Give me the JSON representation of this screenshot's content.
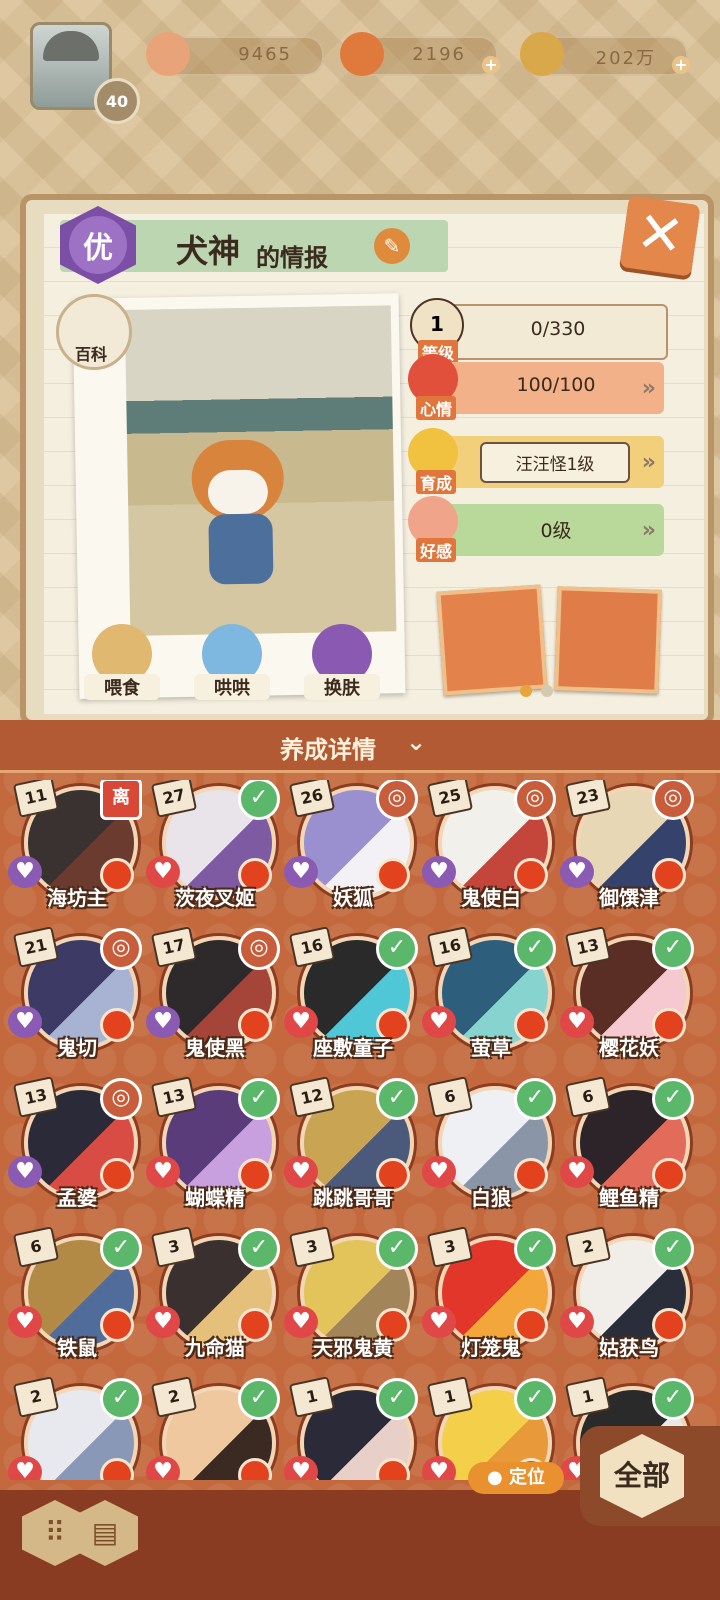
{
  "player": {
    "level": "40"
  },
  "resources": [
    {
      "name": "jade",
      "value": "9465",
      "icon": "flower-jade-icon",
      "color": "#e8a478"
    },
    {
      "name": "stamina",
      "value": "2196",
      "icon": "stamina-icon",
      "color": "#e07a3c"
    },
    {
      "name": "coins",
      "value": "202万",
      "icon": "coin-icon",
      "color": "#d9a84a"
    }
  ],
  "card": {
    "grade": "优",
    "name": "犬神",
    "name_suffix": "的情报",
    "baike_label": "百科",
    "actions": [
      {
        "label": "喂食",
        "icon": "noodle-bowl-icon",
        "color": "#e0b870"
      },
      {
        "label": "哄哄",
        "icon": "milk-carton-icon",
        "color": "#7eb7df"
      },
      {
        "label": "换肤",
        "icon": "skin-swap-icon",
        "color": "#8a5ab2"
      }
    ],
    "stats": [
      {
        "key": "level",
        "label": "等级",
        "value": "0/330",
        "icon_text": "1",
        "bg": "#f3ead6",
        "icon_color": "#f0e2c5"
      },
      {
        "key": "mood",
        "label": "心情",
        "value": "100/100",
        "icon_text": "",
        "bg": "#f3b18a",
        "icon_color": "#e0503a"
      },
      {
        "key": "growth",
        "label": "育成",
        "value": "汪汪怪1级",
        "icon_text": "",
        "bg": "#f1cf7b",
        "icon_color": "#f0c240"
      },
      {
        "key": "affection",
        "label": "好感",
        "value": "0级",
        "icon_text": "",
        "bg": "#b8d99a",
        "icon_color": "#f0a58a"
      }
    ],
    "page_dots": [
      {
        "color": "#e8a63a"
      },
      {
        "color": "#d6c9b2"
      }
    ]
  },
  "detail_label": "养成详情",
  "shikigami": [
    {
      "name": "海坊主",
      "level": "11",
      "badge": "离",
      "badge_type": "away",
      "heart_color": "#8b5ab3",
      "colors": [
        "#3a3230",
        "#6b3b30"
      ]
    },
    {
      "name": "茨夜叉姬",
      "level": "27",
      "badge": "✓",
      "badge_type": "check",
      "heart_color": "#e04848",
      "colors": [
        "#e8e4ea",
        "#7e5aa2"
      ]
    },
    {
      "name": "妖狐",
      "level": "26",
      "badge": "◎",
      "badge_type": "ring",
      "heart_color": "#8b5ab3",
      "colors": [
        "#9a8fcf",
        "#f3f1f5"
      ]
    },
    {
      "name": "鬼使白",
      "level": "25",
      "badge": "◎",
      "badge_type": "ring",
      "heart_color": "#8b5ab3",
      "colors": [
        "#f2f0ea",
        "#c4453a"
      ]
    },
    {
      "name": "御馔津",
      "level": "23",
      "badge": "◎",
      "badge_type": "ring",
      "heart_color": "#8b5ab3",
      "colors": [
        "#e8d7b5",
        "#35436c"
      ]
    },
    {
      "name": "鬼切",
      "level": "21",
      "badge": "◎",
      "badge_type": "ring",
      "heart_color": "#8b5ab3",
      "colors": [
        "#3d3b66",
        "#a8b3d4"
      ]
    },
    {
      "name": "鬼使黑",
      "level": "17",
      "badge": "◎",
      "badge_type": "ring",
      "heart_color": "#8b5ab3",
      "colors": [
        "#2e2a2c",
        "#a5453a"
      ]
    },
    {
      "name": "座敷童子",
      "level": "16",
      "badge": "✓",
      "badge_type": "check",
      "heart_color": "#e04848",
      "colors": [
        "#2a2a2a",
        "#4fc7d6"
      ]
    },
    {
      "name": "萤草",
      "level": "16",
      "badge": "✓",
      "badge_type": "check",
      "heart_color": "#e04848",
      "colors": [
        "#2d5f7d",
        "#86d3cf"
      ]
    },
    {
      "name": "樱花妖",
      "level": "13",
      "badge": "✓",
      "badge_type": "check",
      "heart_color": "#e04848",
      "colors": [
        "#5a2e24",
        "#f6c8cf"
      ]
    },
    {
      "name": "孟婆",
      "level": "13",
      "badge": "◎",
      "badge_type": "ring",
      "heart_color": "#8b5ab3",
      "colors": [
        "#2b2a38",
        "#d94c43"
      ]
    },
    {
      "name": "蝴蝶精",
      "level": "13",
      "badge": "✓",
      "badge_type": "check",
      "heart_color": "#e04848",
      "colors": [
        "#5b3c7a",
        "#c8a0e0"
      ]
    },
    {
      "name": "跳跳哥哥",
      "level": "12",
      "badge": "✓",
      "badge_type": "check",
      "heart_color": "#e04848",
      "colors": [
        "#c9a453",
        "#4b5a7a"
      ]
    },
    {
      "name": "白狼",
      "level": "6",
      "badge": "✓",
      "badge_type": "check",
      "heart_color": "#e04848",
      "colors": [
        "#eef0f4",
        "#8a95a8"
      ]
    },
    {
      "name": "鲤鱼精",
      "level": "6",
      "badge": "✓",
      "badge_type": "check",
      "heart_color": "#e04848",
      "colors": [
        "#2c2428",
        "#e36b5a"
      ]
    },
    {
      "name": "铁鼠",
      "level": "6",
      "badge": "✓",
      "badge_type": "check",
      "heart_color": "#e04848",
      "colors": [
        "#b28a46",
        "#4f6c9a"
      ]
    },
    {
      "name": "九命猫",
      "level": "3",
      "badge": "✓",
      "badge_type": "check",
      "heart_color": "#e04848",
      "colors": [
        "#3a3030",
        "#e4c07a"
      ]
    },
    {
      "name": "天邪鬼黄",
      "level": "3",
      "badge": "✓",
      "badge_type": "check",
      "heart_color": "#e04848",
      "colors": [
        "#e3c45a",
        "#a3855a"
      ]
    },
    {
      "name": "灯笼鬼",
      "level": "3",
      "badge": "✓",
      "badge_type": "check",
      "heart_color": "#e04848",
      "colors": [
        "#e2362a",
        "#f3a63a"
      ]
    },
    {
      "name": "姑获鸟",
      "level": "2",
      "badge": "✓",
      "badge_type": "check",
      "heart_color": "#e04848",
      "colors": [
        "#f1eee9",
        "#2a2e3a"
      ]
    },
    {
      "name": "",
      "level": "2",
      "badge": "✓",
      "badge_type": "check",
      "heart_color": "#e04848",
      "colors": [
        "#e8e9ef",
        "#8a98b8"
      ]
    },
    {
      "name": "",
      "level": "2",
      "badge": "✓",
      "badge_type": "check",
      "heart_color": "#e04848",
      "colors": [
        "#f0c8a0",
        "#3a2a22"
      ]
    },
    {
      "name": "",
      "level": "1",
      "badge": "✓",
      "badge_type": "check",
      "heart_color": "#e04848",
      "colors": [
        "#2a2a38",
        "#e8d0c8"
      ]
    },
    {
      "name": "",
      "level": "1",
      "badge": "✓",
      "badge_type": "check",
      "heart_color": "#e04848",
      "colors": [
        "#f4d04a",
        "#e89a3a"
      ]
    },
    {
      "name": "",
      "level": "1",
      "badge": "✓",
      "badge_type": "check",
      "heart_color": "#e04848",
      "colors": [
        "#2a2a2a",
        "#e8e8e8"
      ]
    }
  ],
  "locate_label": "定位",
  "all_label": "全部",
  "view_modes": [
    {
      "icon": "grid-view-icon",
      "glyph": "⠿"
    },
    {
      "icon": "list-view-icon",
      "glyph": "▤"
    }
  ]
}
